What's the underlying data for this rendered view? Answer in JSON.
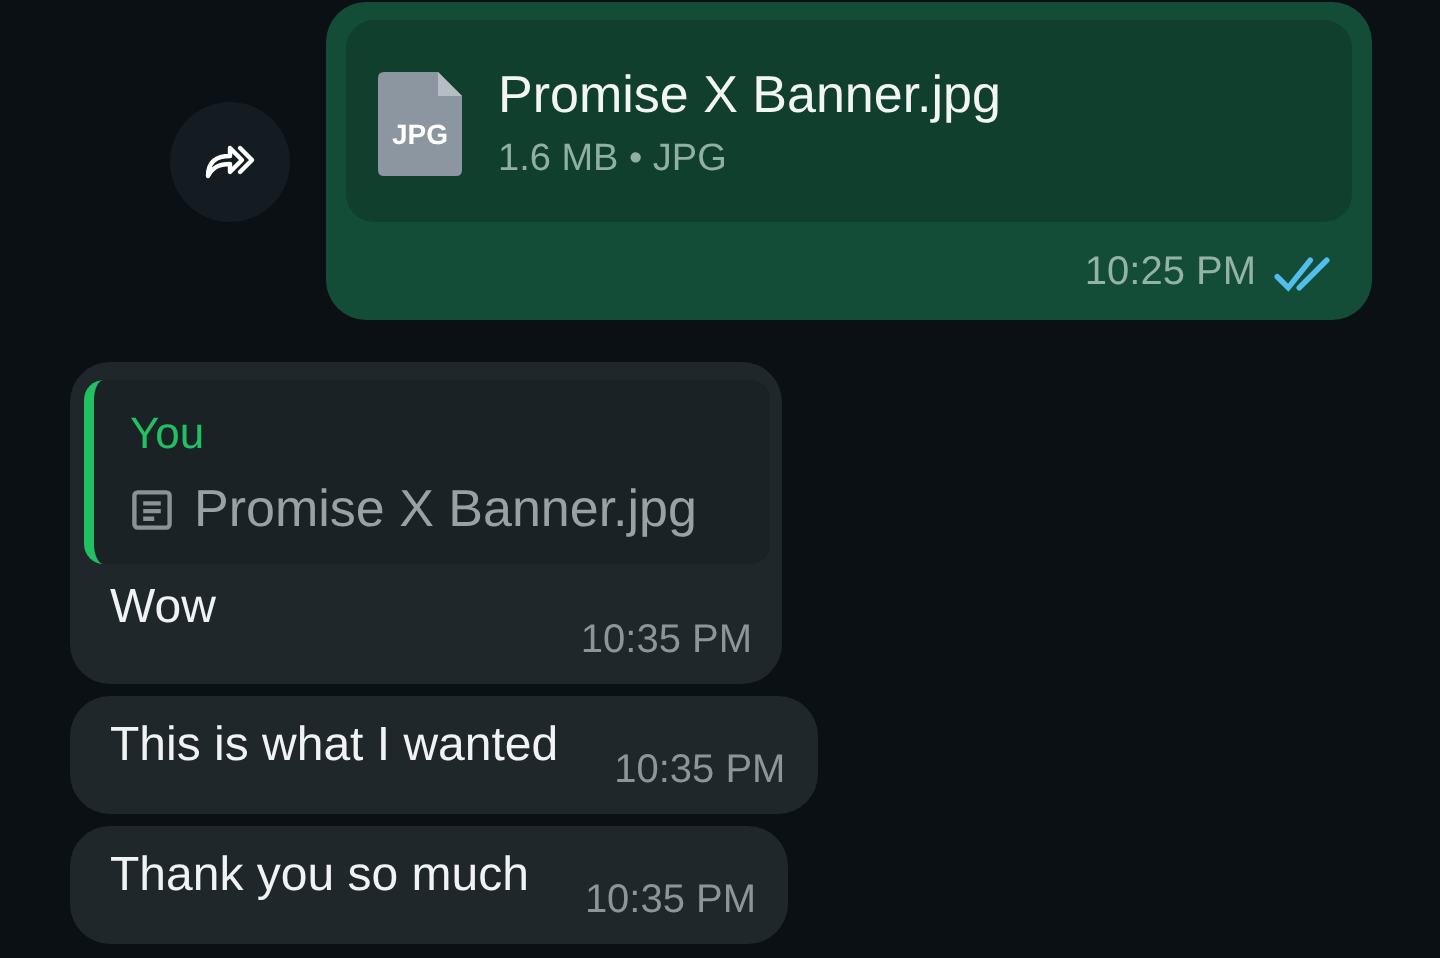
{
  "messages": [
    {
      "kind": "document",
      "outgoing": true,
      "file_name": "Promise X Banner.jpg",
      "file_badge": "JPG",
      "file_info": "1.6 MB • JPG",
      "time": "10:25 PM",
      "read": true
    },
    {
      "kind": "reply",
      "outgoing": false,
      "quote": {
        "author": "You",
        "text": "Promise X Banner.jpg"
      },
      "text": "Wow",
      "time": "10:35 PM"
    },
    {
      "kind": "text",
      "outgoing": false,
      "text": "This is what I wanted",
      "time": "10:35 PM"
    },
    {
      "kind": "text",
      "outgoing": false,
      "text": "Thank you so much",
      "time": "10:35 PM"
    }
  ]
}
